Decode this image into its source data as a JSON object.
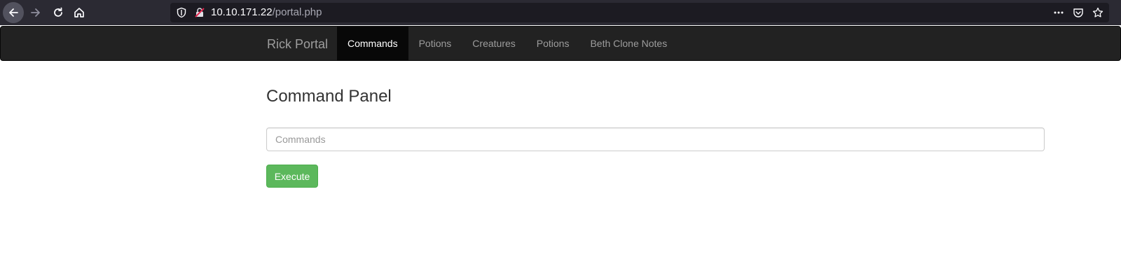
{
  "browser": {
    "url_host": "10.10.171.22",
    "url_path": "/portal.php",
    "icons": [
      "back-icon",
      "forward-icon",
      "reload-icon",
      "home-icon",
      "shield-icon",
      "insecure-lock-icon",
      "more-icon",
      "pocket-icon",
      "bookmark-star-icon"
    ]
  },
  "navbar": {
    "brand": "Rick Portal",
    "items": [
      {
        "label": "Commands",
        "active": true
      },
      {
        "label": "Potions",
        "active": false
      },
      {
        "label": "Creatures",
        "active": false
      },
      {
        "label": "Potions",
        "active": false
      },
      {
        "label": "Beth Clone Notes",
        "active": false
      }
    ]
  },
  "main": {
    "title": "Command Panel",
    "command_input": {
      "placeholder": "Commands",
      "value": ""
    },
    "execute_label": "Execute"
  },
  "colors": {
    "navbar_bg": "#222222",
    "navbar_active_bg": "#080808",
    "execute_button": "#5cb85c",
    "browser_bar": "#2b2a33",
    "urlbar": "#1c1b22"
  }
}
